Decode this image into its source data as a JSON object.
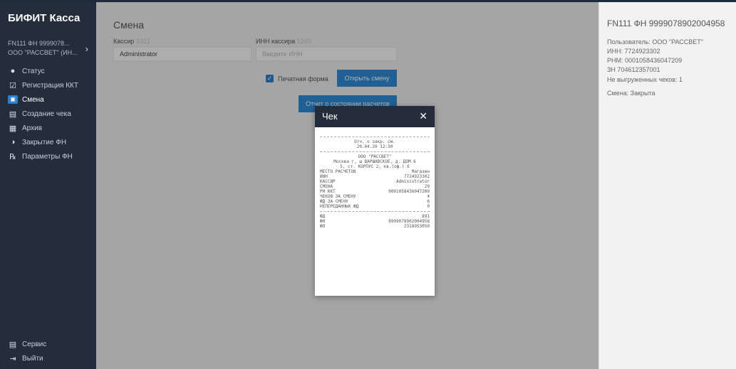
{
  "sidebar": {
    "brand": "БИФИТ Касса",
    "device_line1": "FN111 ФН 9999078...",
    "device_line2": "ООО \"РАССВЕТ\" (ИН...",
    "items": [
      {
        "label": "Статус",
        "icon": "status-icon"
      },
      {
        "label": "Регистрация ККТ",
        "icon": "registration-icon"
      },
      {
        "label": "Смена",
        "icon": "shift-icon"
      },
      {
        "label": "Создание чека",
        "icon": "receipt-create-icon"
      },
      {
        "label": "Архив",
        "icon": "archive-icon"
      },
      {
        "label": "Закрытие ФН",
        "icon": "fn-close-icon"
      },
      {
        "label": "Параметры ФН",
        "icon": "fn-params-icon"
      }
    ],
    "bottom": [
      {
        "label": "Сервис",
        "icon": "service-icon"
      },
      {
        "label": "Выйти",
        "icon": "logout-icon"
      }
    ]
  },
  "main": {
    "title": "Смена",
    "cashier_label": "Кассир",
    "cashier_tag": "1021",
    "cashier_value": "Administrator",
    "inn_label": "ИНН кассира",
    "inn_tag": "1203",
    "inn_placeholder": "Введите ИНН",
    "print_form_label": "Печатная форма",
    "open_shift_button": "Открыть смену",
    "report_button": "Отчет о состоянии расчетов"
  },
  "info": {
    "title": "FN111 ФН 9999078902004958",
    "user": "Пользователь: ООО \"РАССВЕТ\"",
    "inn": "ИНН: 7724923302",
    "rnm": "РНМ: 0001058436047209",
    "zn": "ЗН      704612357001",
    "unsent": "Не выгруженных чеков: 1",
    "shift": "Смена: Закрыта"
  },
  "modal": {
    "title": "Чек",
    "receipt": {
      "header1": "Отч. о закр. см.",
      "header2": "20.04.20 12:30",
      "org": "ООО \"РАССВЕТ\"",
      "addr1": "Москва г, ш ВАРШАВСКОЕ, д. ДОМ 6",
      "addr2": "5, ст. КОРПУС 2, кв.(оф.) 6",
      "rows": [
        {
          "k": "МЕСТО РАСЧЕТОВ",
          "v": "Магазин"
        },
        {
          "k": "ИНН",
          "v": "7724923302"
        },
        {
          "k": "КАССИР",
          "v": "Administrator"
        },
        {
          "k": "СМЕНА",
          "v": "29"
        },
        {
          "k": "РН ККТ",
          "v": "0001058436047209"
        },
        {
          "k": "ЧЕКОВ ЗА СМЕНУ",
          "v": "4"
        },
        {
          "k": "ФД ЗА СМЕНУ",
          "v": "6"
        },
        {
          "k": "НЕПЕРЕДАННЫХ ФД",
          "v": "0"
        }
      ],
      "footer": [
        {
          "k": "ФД",
          "v": "891"
        },
        {
          "k": "ФН",
          "v": "9999078902004958"
        },
        {
          "k": "ФП",
          "v": "2318953050"
        }
      ]
    }
  },
  "colors": {
    "sidebar": "#232d3b",
    "accent": "#2f8ad6",
    "main_bg": "#ececec"
  }
}
